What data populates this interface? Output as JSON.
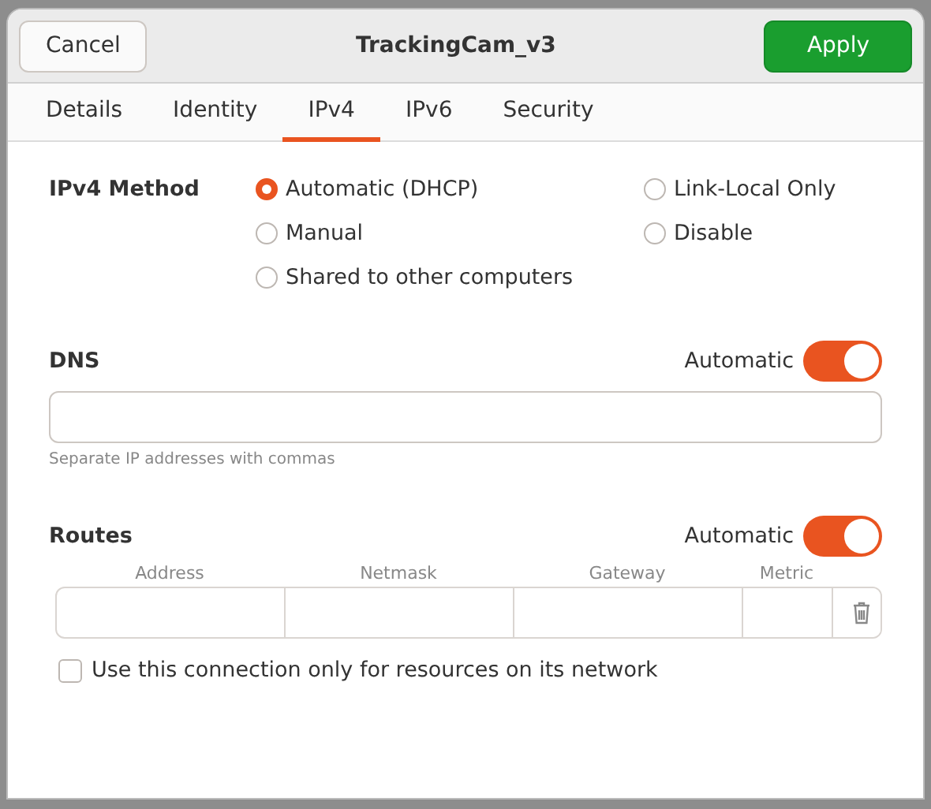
{
  "window": {
    "title": "TrackingCam_v3"
  },
  "header_buttons": [
    {
      "label": "Cancel",
      "kind": "normal"
    },
    {
      "label": "Apply",
      "kind": "suggested"
    }
  ],
  "tabs": [
    {
      "label": "Details",
      "selected": false
    },
    {
      "label": "Identity",
      "selected": false
    },
    {
      "label": "IPv4",
      "selected": true
    },
    {
      "label": "IPv6",
      "selected": false
    },
    {
      "label": "Security",
      "selected": false
    }
  ],
  "method": {
    "label": "IPv4 Method",
    "options": [
      {
        "label": "Automatic (DHCP)",
        "selected": true
      },
      {
        "label": "Link-Local Only",
        "selected": false
      },
      {
        "label": "Manual",
        "selected": false
      },
      {
        "label": "Disable",
        "selected": false
      },
      {
        "label": "Shared to other computers",
        "selected": false
      }
    ]
  },
  "dns": {
    "label": "DNS",
    "switch_label": "Automatic",
    "on": true,
    "hint": "Separate IP addresses with commas"
  },
  "routes": {
    "label": "Routes",
    "switch_label": "Automatic",
    "on": true,
    "columns": [
      "Address",
      "Netmask",
      "Gateway",
      "Metric"
    ]
  },
  "only_local": {
    "label": "Use this connection only for resources on its network",
    "checked": false
  }
}
